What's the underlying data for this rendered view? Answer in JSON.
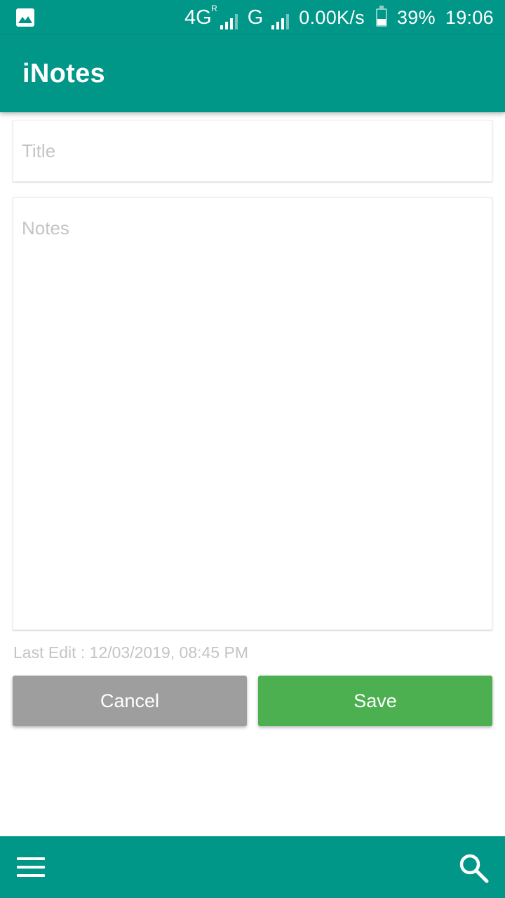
{
  "status_bar": {
    "network_primary": "4G",
    "roaming_mark": "R",
    "network_secondary": "G",
    "data_rate": "0.00K/s",
    "battery_percent": "39%",
    "battery_level": 0.39,
    "time": "19:06",
    "icons": [
      "gallery-notification-icon",
      "signal-icon",
      "battery-icon"
    ]
  },
  "app_bar": {
    "title": "iNotes"
  },
  "editor": {
    "title_placeholder": "Title",
    "title_value": "",
    "notes_placeholder": "Notes",
    "notes_value": "",
    "last_edit": "Last Edit : 12/03/2019, 08:45 PM"
  },
  "actions": {
    "cancel_label": "Cancel",
    "save_label": "Save"
  },
  "bottom_bar": {
    "icons": [
      "menu-icon",
      "search-icon"
    ]
  },
  "colors": {
    "primary": "#009688",
    "save": "#4caf50",
    "cancel": "#9e9e9e",
    "hint": "#c4c4c4"
  }
}
